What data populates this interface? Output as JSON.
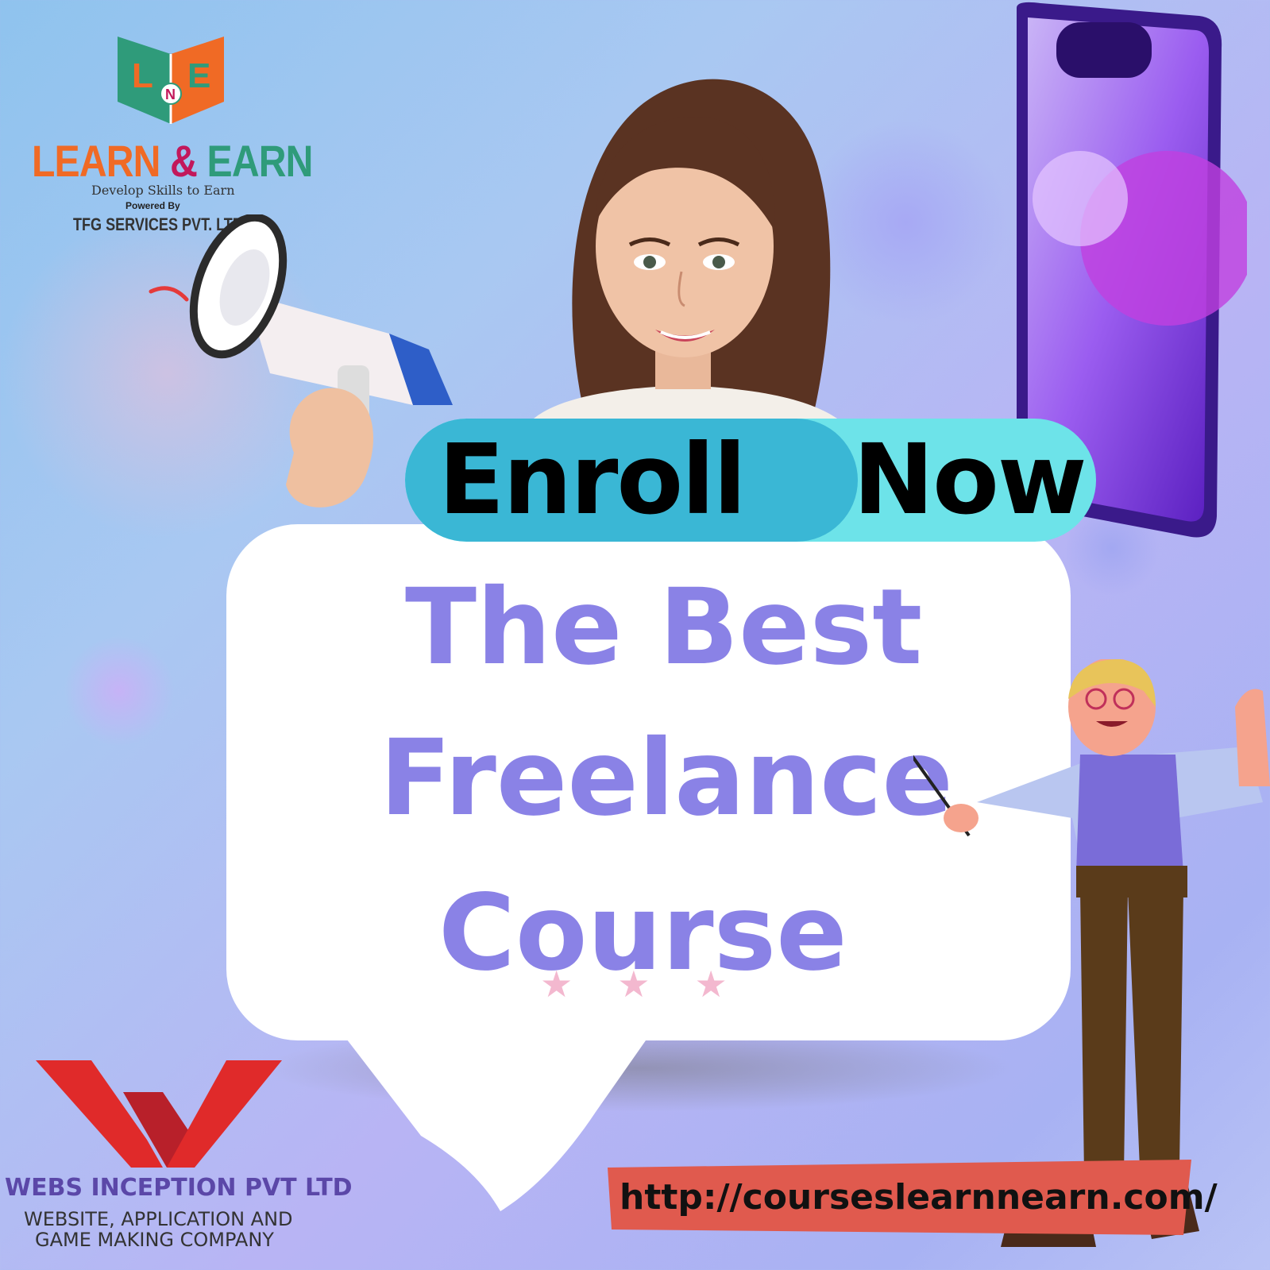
{
  "logo_top": {
    "title_part1": "LEARN ",
    "title_amp": "&",
    "title_part2": " EARN",
    "tagline": "Develop Skills to Earn",
    "powered_by": "Powered By",
    "company": "TFG SERVICES PVT. LTD.",
    "book_letters": [
      "L",
      "N",
      "E"
    ]
  },
  "enroll": {
    "word1": "Enroll",
    "word2": "Now",
    "color_left": "#3ab7d5",
    "color_right": "#6de3e9"
  },
  "headline": {
    "line1": "The Best",
    "line2": "Freelance",
    "line3": "Course",
    "color": "#8a82e6"
  },
  "stars": "★★★",
  "url": "http://courseslearnnearn.com/",
  "webs_logo": {
    "name": "WEBS INCEPTION PVT LTD",
    "sub_line1": "WEBSITE, APPLICATION AND",
    "sub_line2": "GAME MAKING COMPANY",
    "mark_color": "#e02a2a"
  }
}
